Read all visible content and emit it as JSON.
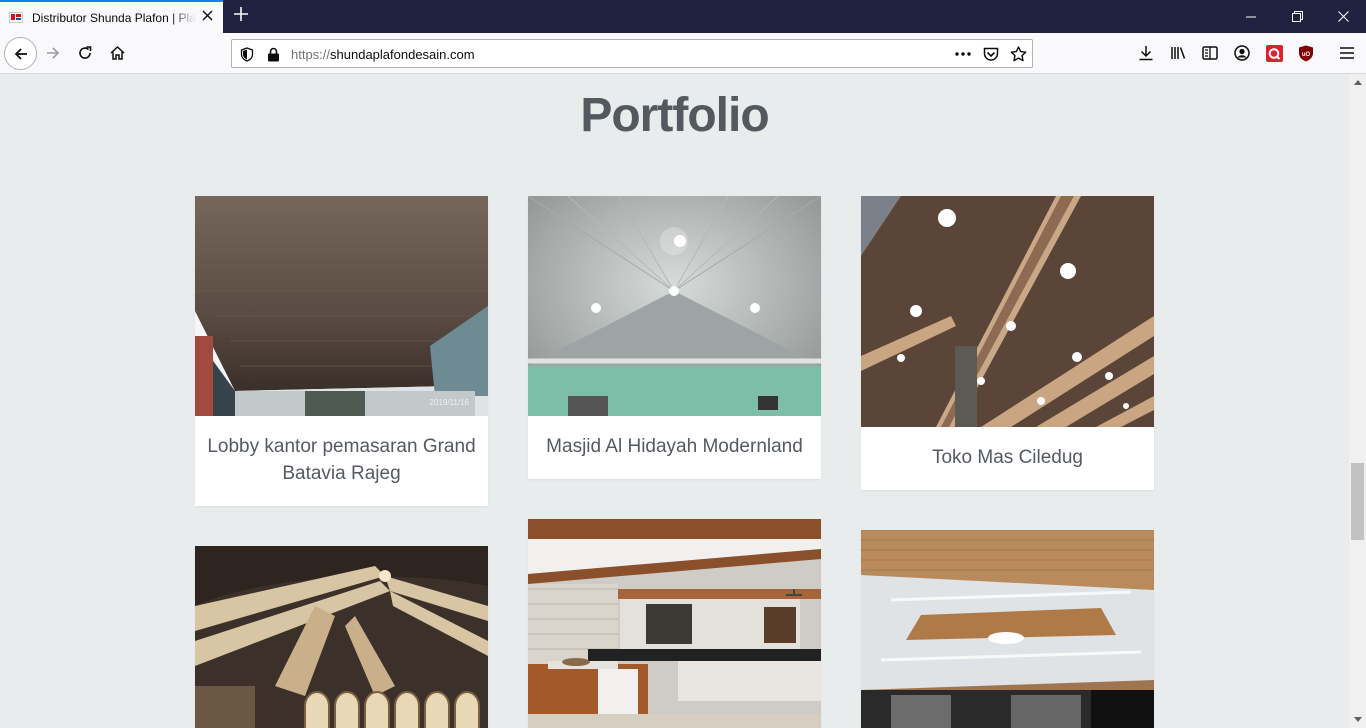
{
  "browser": {
    "tab_title": "Distributor Shunda Plafon | Plafon PVC",
    "url_protocol": "https://",
    "url_host": "shundaplafondesain.com",
    "accent_color": "#0a84ff"
  },
  "page": {
    "heading": "Portfolio",
    "items": [
      {
        "caption": "Lobby kantor pemasaran Grand Batavia Rajeg",
        "photo_stamp": "2019/11/16"
      },
      {
        "caption": "Masjid Al Hidayah Modernland"
      },
      {
        "caption": "Toko Mas Ciledug"
      }
    ]
  }
}
